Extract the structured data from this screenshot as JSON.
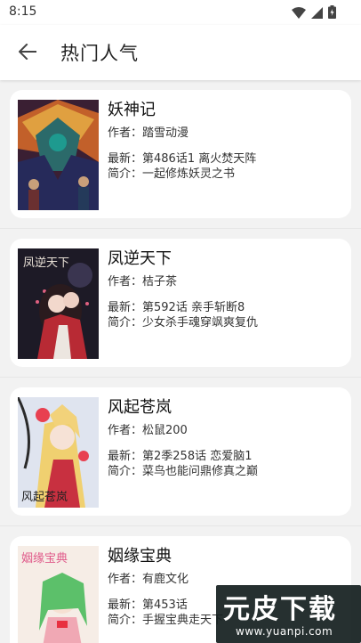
{
  "status_bar": {
    "time": "8:15"
  },
  "header": {
    "title": "热门人气"
  },
  "list": [
    {
      "title": "妖神记",
      "author_label": "作者：",
      "author": "踏雪动漫",
      "latest_label": "最新：",
      "latest": "第486话1 离火焚天阵",
      "intro_label": "简介：",
      "intro": "一起修炼妖灵之书"
    },
    {
      "title": "凤逆天下",
      "author_label": "作者：",
      "author": "桔子茶",
      "latest_label": "最新：",
      "latest": "第592话 亲手斩断8",
      "intro_label": "简介：",
      "intro": "少女杀手魂穿飒爽复仇"
    },
    {
      "title": "风起苍岚",
      "author_label": "作者：",
      "author": "松鼠200",
      "latest_label": "最新：",
      "latest": "第2季258话 恋爱脑1",
      "intro_label": "简介：",
      "intro": "菜鸟也能问鼎修真之巅"
    },
    {
      "title": "姻缘宝典",
      "author_label": "作者：",
      "author": "有鹿文化",
      "latest_label": "最新：",
      "latest": "第453话",
      "intro_label": "简介：",
      "intro": "手握宝典走天下"
    }
  ],
  "covers": [
    {
      "text": ""
    },
    {
      "text": "凤逆天下"
    },
    {
      "text": "风起苍岚"
    },
    {
      "text": "姻缘宝典"
    }
  ],
  "watermark": {
    "main": "元皮下载",
    "url": "www.yuanpi.com"
  }
}
